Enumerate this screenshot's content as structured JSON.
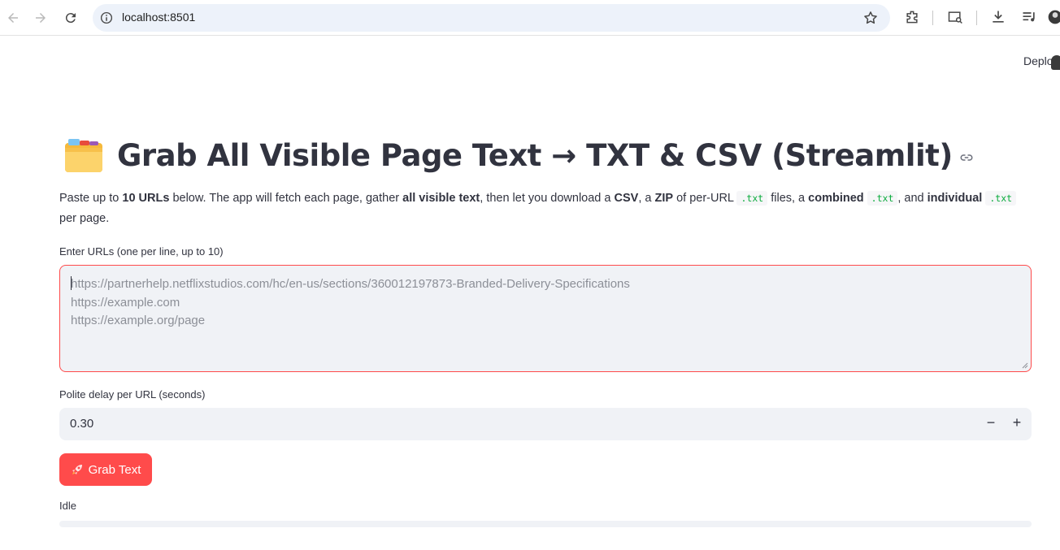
{
  "browser": {
    "url": "localhost:8501"
  },
  "header": {
    "deploy_label": "Deploy"
  },
  "main": {
    "title": "Grab All Visible Page Text → TXT & CSV (Streamlit)",
    "desc": {
      "t1": "Paste up to ",
      "b1": "10 URLs",
      "t2": " below. The app will fetch each page, gather ",
      "b2": "all visible text",
      "t3": ", then let you download a ",
      "b3": "CSV",
      "t4": ", a ",
      "b4": "ZIP",
      "t5": " of per-URL ",
      "c1": ".txt",
      "t6": " files, a ",
      "b5": "combined",
      "t7": " ",
      "c2": ".txt",
      "t8": ", and ",
      "b6": "individual",
      "t9": " ",
      "c3": ".txt",
      "t10": " per page."
    },
    "urls_label": "Enter URLs (one per line, up to 10)",
    "urls_placeholder": [
      "https://partnerhelp.netflixstudios.com/hc/en-us/sections/360012197873-Branded-Delivery-Specifications",
      "https://example.com",
      "https://example.org/page"
    ],
    "delay_label": "Polite delay per URL (seconds)",
    "delay_value": "0.30",
    "minus": "−",
    "plus": "+",
    "grab_button": "Grab Text",
    "status": "Idle",
    "progress": 0
  },
  "colors": {
    "accent": "#ff4b4b",
    "input_bg": "#f0f2f6",
    "text": "#31333f"
  }
}
